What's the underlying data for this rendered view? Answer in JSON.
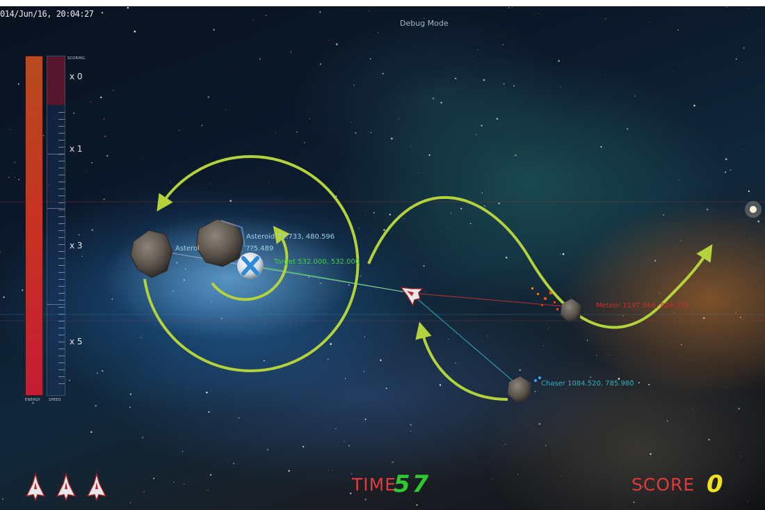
{
  "hud": {
    "datetime": "014/Jun/16, 20:04:27",
    "debug_mode": "Debug Mode",
    "bars": {
      "scoring_label": "SCORING",
      "energy_label": "ENERGY",
      "speed_label": "SPEED",
      "energy_level": 1.0,
      "multipliers": [
        "x 0",
        "x 1",
        "x 3",
        "x 5"
      ]
    },
    "time_label": "TIME",
    "time_value": "57",
    "score_label": "SCORE",
    "score_value": "0",
    "lives_count": 3
  },
  "objects": {
    "asteroid_left_label": "Asterol",
    "asteroid_label": "Asteroid",
    "asteroid_coords": "73.733, 480.596",
    "asteroid_coords_2": "??5.489",
    "target_label": "Target",
    "target_coords": "532.000, 532.000",
    "meteor_label": "Meteor",
    "meteor_coords": "1197.966, 824.378",
    "chaser_label": "Chaser",
    "chaser_coords": "1084.520, 785.980"
  },
  "colors": {
    "energy": "#c83024",
    "time_label": "#e03a3a",
    "time_value": "#30c830",
    "score_value": "#f0e020",
    "arrow": "#b4d23c",
    "target_text": "#40d040",
    "meteor_text": "#c03030",
    "chaser_text": "#30b0c0"
  },
  "icons": [
    "x-marker-icon",
    "ship-icon",
    "life-ship-icon",
    "asteroid-icon",
    "meteor-icon",
    "chaser-icon"
  ]
}
